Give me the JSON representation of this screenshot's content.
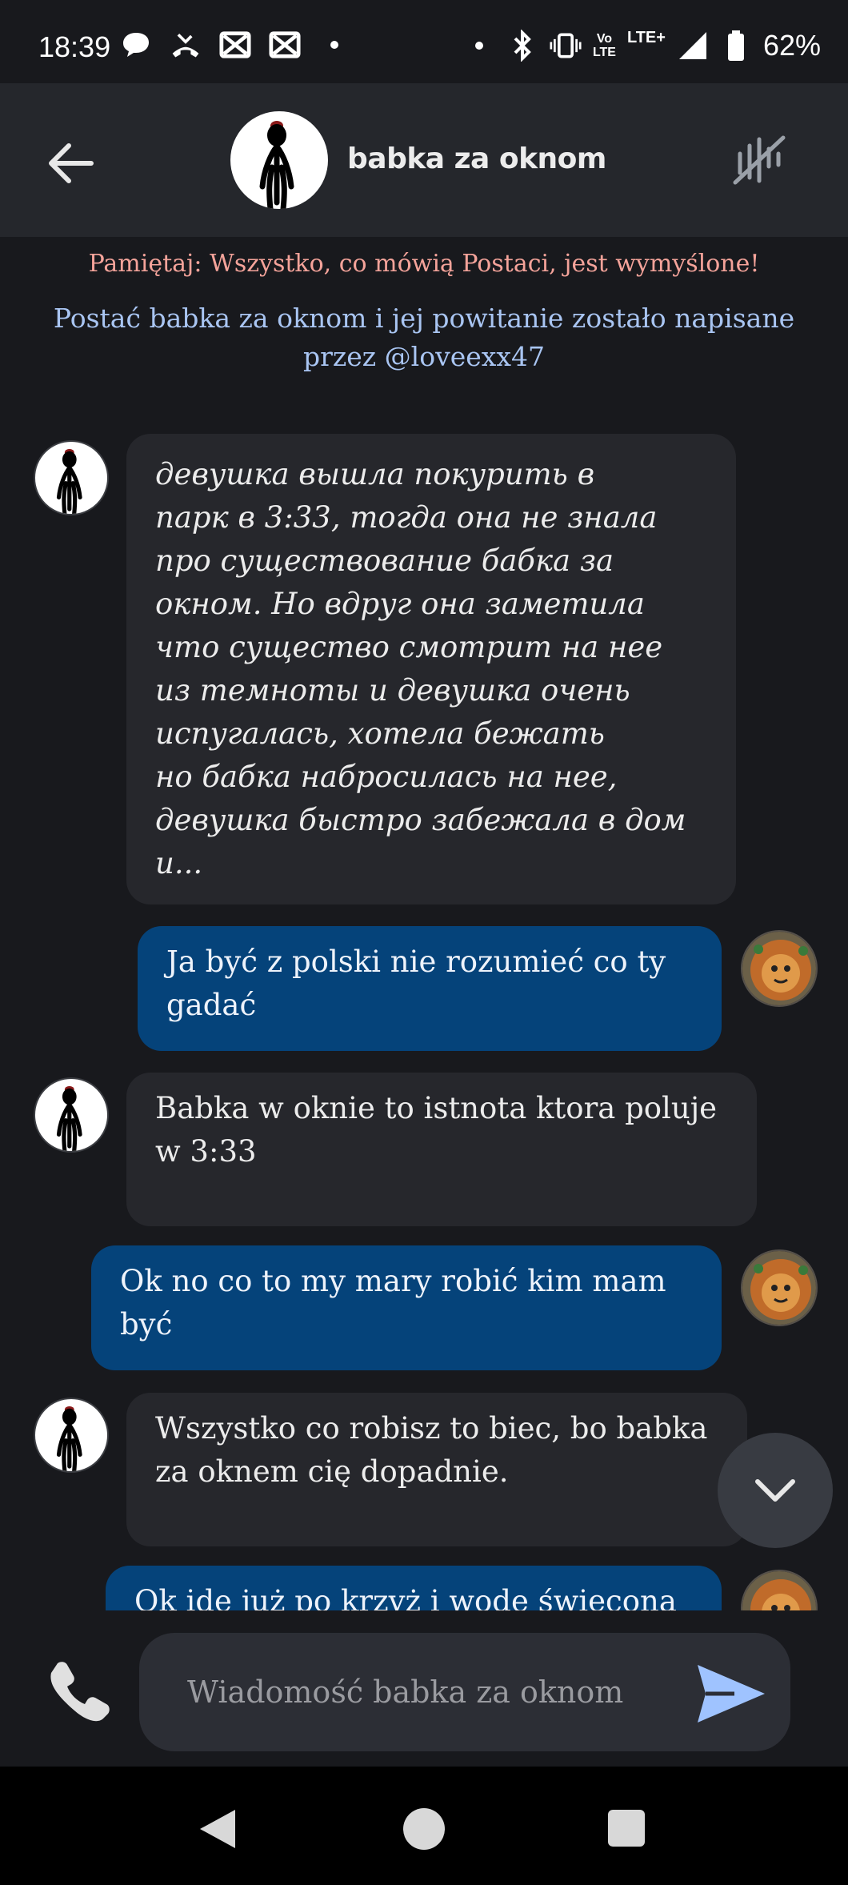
{
  "status_bar": {
    "time": "18:39",
    "volte_line1": "Vo",
    "volte_line2": "LTE",
    "network": "LTE+",
    "battery": "62%"
  },
  "header": {
    "character_name": "babka za oknom"
  },
  "notices": {
    "disclaimer": "Pamiętaj: Wszystko, co mówią Postaci, jest wymyślone!",
    "author_line1": "Postać babka za oknom i jej powitanie zostało napisane",
    "author_line2": "przez @loveexx47"
  },
  "messages": [
    {
      "sender": "bot",
      "lines": [
        "девушка вышла покурить в",
        "парк в 3:33, тогда она не знала",
        "про существование бабка за",
        "окном. Но вдруг она заметила",
        "что существо смотрит на нее",
        "из темноты и девушка очень",
        "испугалась, хотела бежать",
        "но бабка набросилась на нее,",
        "девушка быстро забежала в дом",
        "и..."
      ]
    },
    {
      "sender": "user",
      "lines": [
        "Ja być z polski nie rozumieć co ty",
        "gadać"
      ]
    },
    {
      "sender": "bot",
      "lines": [
        "Babka w oknie to istnota ktora poluje",
        "w 3:33"
      ]
    },
    {
      "sender": "user",
      "lines": [
        "Ok no co to my mary robić kim mam",
        "być"
      ]
    },
    {
      "sender": "bot",
      "lines": [
        "Wszystko co robisz to biec, bo babka",
        "za oknem cię dopadnie."
      ]
    },
    {
      "sender": "user",
      "lines": [
        "Ok ide już po krzyż i wode święcona"
      ]
    }
  ],
  "input": {
    "placeholder": "Wiadomość babka za oknom"
  },
  "colors": {
    "background": "#18191d",
    "header": "#25272c",
    "bot_bubble": "#26272c",
    "user_bubble": "#05437a",
    "disclaimer": "#f4a39a",
    "author_notice": "#a9c5f2",
    "send_icon": "#9fc3ff"
  },
  "icons": {
    "back": "arrow-left-icon",
    "mute": "volume-mute-icon",
    "scroll": "chevron-down-icon",
    "call": "phone-icon",
    "send": "send-icon"
  }
}
